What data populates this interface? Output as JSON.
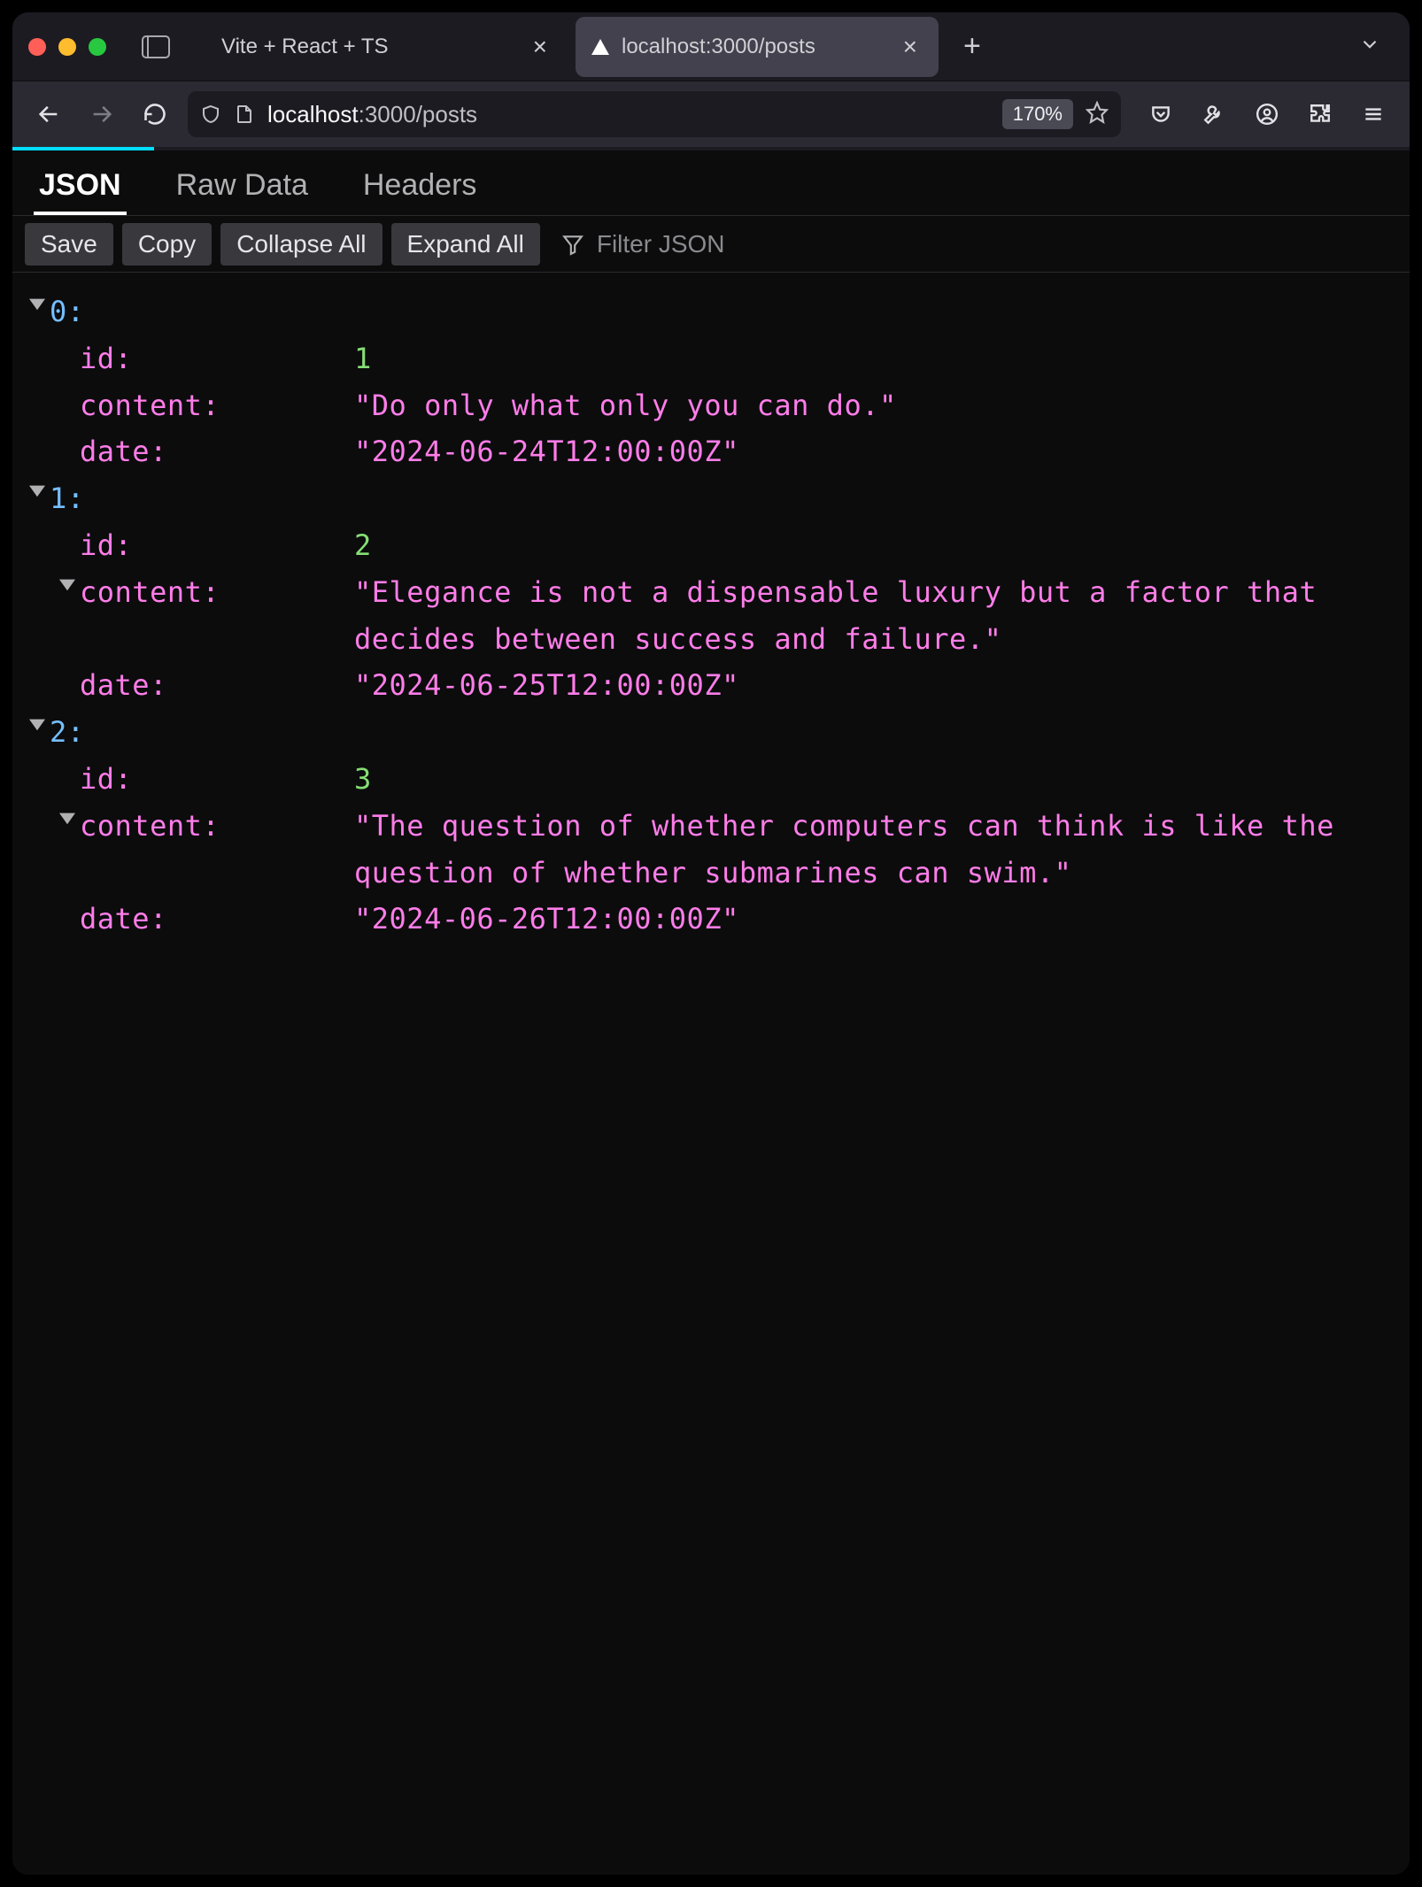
{
  "tabs": [
    {
      "label": "Vite + React + TS",
      "active": false,
      "has_favicon": false
    },
    {
      "label": "localhost:3000/posts",
      "active": true,
      "has_favicon": true
    }
  ],
  "url": {
    "prefix": "localhost",
    "rest": ":3000/posts"
  },
  "zoom": "170%",
  "view_tabs": {
    "json": "JSON",
    "raw": "Raw Data",
    "headers": "Headers"
  },
  "actions": {
    "save": "Save",
    "copy": "Copy",
    "collapse": "Collapse All",
    "expand": "Expand All"
  },
  "filter_placeholder": "Filter JSON",
  "json": {
    "items": [
      {
        "idx": "0:",
        "rows": [
          {
            "key": "id:",
            "val": "1",
            "type": "num"
          },
          {
            "key": "content:",
            "val": "\"Do only what only you can do.\"",
            "type": "str"
          },
          {
            "key": "date:",
            "val": "\"2024-06-24T12:00:00Z\"",
            "type": "str"
          }
        ]
      },
      {
        "idx": "1:",
        "rows": [
          {
            "key": "id:",
            "val": "2",
            "type": "num"
          },
          {
            "key": "content:",
            "val": "\"Elegance is not a dispensable luxury but a factor that decides between success and failure.\"",
            "type": "str",
            "twisty": true
          },
          {
            "key": "date:",
            "val": "\"2024-06-25T12:00:00Z\"",
            "type": "str"
          }
        ]
      },
      {
        "idx": "2:",
        "rows": [
          {
            "key": "id:",
            "val": "3",
            "type": "num"
          },
          {
            "key": "content:",
            "val": "\"The question of whether computers can think is like the question of whether submarines can swim.\"",
            "type": "str",
            "twisty": true
          },
          {
            "key": "date:",
            "val": "\"2024-06-26T12:00:00Z\"",
            "type": "str"
          }
        ]
      }
    ]
  }
}
